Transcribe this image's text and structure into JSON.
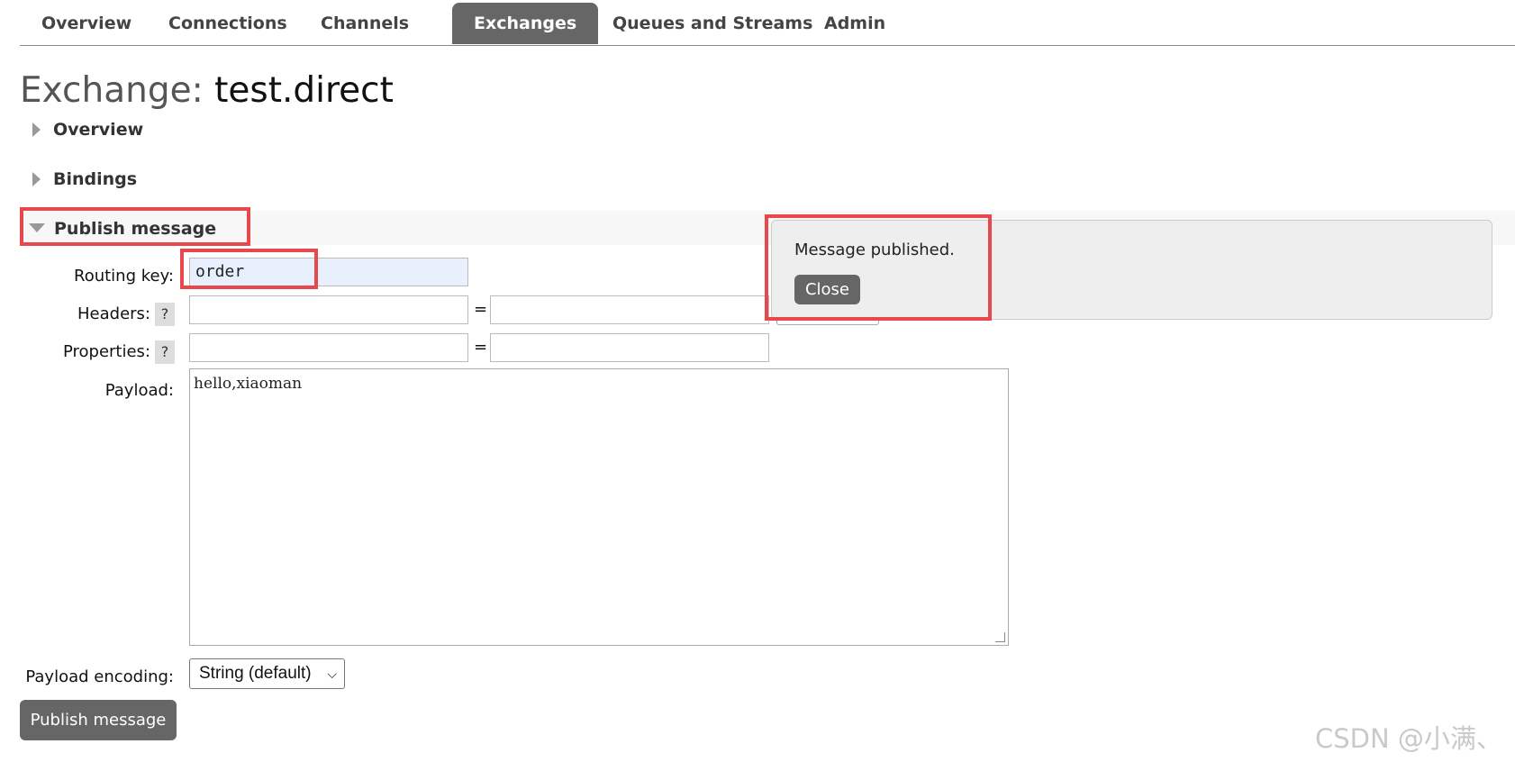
{
  "nav": {
    "tabs": [
      {
        "label": "Overview",
        "active": false
      },
      {
        "label": "Connections",
        "active": false
      },
      {
        "label": "Channels",
        "active": false
      },
      {
        "label": "Exchanges",
        "active": true
      },
      {
        "label": "Queues and Streams",
        "active": false
      },
      {
        "label": "Admin",
        "active": false
      }
    ]
  },
  "page": {
    "title_prefix": "Exchange:",
    "title_name": "test.direct"
  },
  "sections": {
    "overview": "Overview",
    "bindings": "Bindings",
    "publish": "Publish message"
  },
  "form": {
    "routing_key_label": "Routing key:",
    "routing_key_value": "order",
    "headers_label": "Headers:",
    "properties_label": "Properties:",
    "help_glyph": "?",
    "equals": "=",
    "payload_label": "Payload:",
    "payload_value": "hello,xiaoman",
    "encoding_label": "Payload encoding:",
    "encoding_value": "String (default)",
    "submit_label": "Publish message"
  },
  "popup": {
    "message": "Message published.",
    "close_label": "Close"
  },
  "watermark": "CSDN @小满、",
  "colors": {
    "nav_active_bg": "#666666",
    "highlight_border": "#e8474b",
    "autofill_bg": "#e8f0fe",
    "popup_bg": "#eeeeee"
  }
}
